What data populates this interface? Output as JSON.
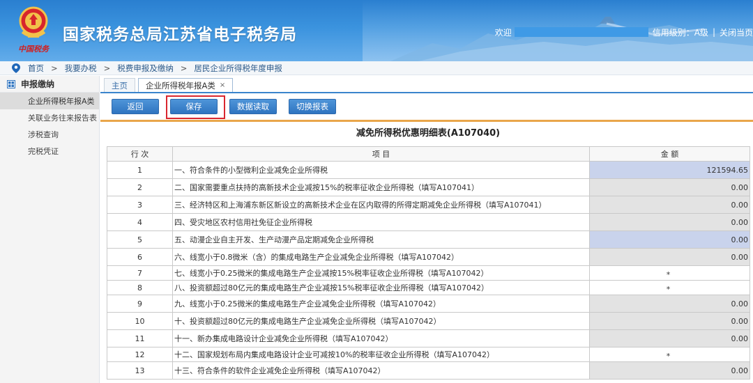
{
  "header": {
    "slogan": "中国税务",
    "title": "国家税务总局江苏省电子税务局",
    "welcome": "欢迎",
    "credit": "信用级别：A级",
    "separator": "|",
    "logout": "关闭当页",
    "colors": {
      "banner": "#3b93de",
      "slogan": "#d21f1f"
    }
  },
  "breadcrumb": {
    "icon": "location-pin-icon",
    "items": [
      "首页",
      "我要办税",
      "税费申报及缴纳",
      "居民企业所得税年度申报"
    ],
    "separator": ">"
  },
  "sidebar": {
    "header": "申报缴纳",
    "icon": "grid-icon",
    "items": [
      {
        "label": "企业所得税年报A类",
        "active": true
      },
      {
        "label": "关联业务往来报告表",
        "active": false
      },
      {
        "label": "涉税查询",
        "active": false
      },
      {
        "label": "完税凭证",
        "active": false
      }
    ]
  },
  "tabs": [
    {
      "label": "主页",
      "active": false
    },
    {
      "label": "企业所得税年报A类",
      "active": true,
      "close": "×"
    }
  ],
  "toolbar": {
    "back": "返回",
    "save": "保存",
    "read": "数据读取",
    "switch": "切换报表",
    "highlight_color": "#d9262e"
  },
  "form": {
    "title": "减免所得税优惠明细表(A107040)",
    "columns": {
      "row": "行 次",
      "item": "项 目",
      "amount": "金 额"
    },
    "rows": [
      {
        "no": "1",
        "item": "一、符合条件的小型微利企业减免企业所得税",
        "amount": "121594.65",
        "style": "editable"
      },
      {
        "no": "2",
        "item": "二、国家需要重点扶持的高新技术企业减按15%的税率征收企业所得税（填写A107041）",
        "amount": "0.00",
        "style": "locked"
      },
      {
        "no": "3",
        "item": "三、经济特区和上海浦东新区新设立的高新技术企业在区内取得的所得定期减免企业所得税（填写A107041）",
        "amount": "0.00",
        "style": "locked"
      },
      {
        "no": "4",
        "item": "四、受灾地区农村信用社免征企业所得税",
        "amount": "0.00",
        "style": "locked"
      },
      {
        "no": "5",
        "item": "五、动漫企业自主开发、生产动漫产品定期减免企业所得税",
        "amount": "0.00",
        "style": "editable"
      },
      {
        "no": "6",
        "item": "六、线宽小于0.8微米（含）的集成电路生产企业减免企业所得税（填写A107042）",
        "amount": "0.00",
        "style": "locked"
      },
      {
        "no": "7",
        "item": "七、线宽小于0.25微米的集成电路生产企业减按15%税率征收企业所得税（填写A107042）",
        "amount": "*",
        "style": "star"
      },
      {
        "no": "8",
        "item": "八、投资额超过80亿元的集成电路生产企业减按15%税率征收企业所得税（填写A107042）",
        "amount": "*",
        "style": "star"
      },
      {
        "no": "9",
        "item": "九、线宽小于0.25微米的集成电路生产企业减免企业所得税（填写A107042）",
        "amount": "0.00",
        "style": "locked"
      },
      {
        "no": "10",
        "item": "十、投资额超过80亿元的集成电路生产企业减免企业所得税（填写A107042）",
        "amount": "0.00",
        "style": "locked"
      },
      {
        "no": "11",
        "item": "十一、新办集成电路设计企业减免企业所得税（填写A107042）",
        "amount": "0.00",
        "style": "locked"
      },
      {
        "no": "12",
        "item": "十二、国家规划布局内集成电路设计企业可减按10%的税率征收企业所得税（填写A107042）",
        "amount": "*",
        "style": "star"
      },
      {
        "no": "13",
        "item": "十三、符合条件的软件企业减免企业所得税（填写A107042）",
        "amount": "0.00",
        "style": "locked"
      }
    ]
  }
}
